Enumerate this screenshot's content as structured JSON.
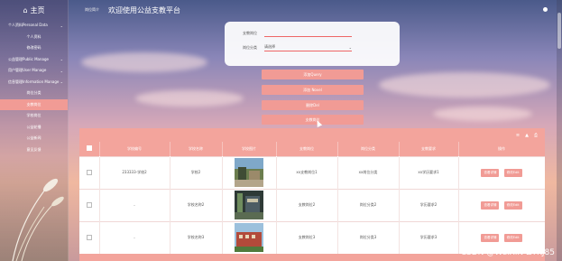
{
  "sidebar": {
    "brand": "主页",
    "items": [
      {
        "label": "个人资料Personal Data",
        "type": "group"
      },
      {
        "label": "个人资料",
        "type": "item"
      },
      {
        "label": "修改密码",
        "type": "item"
      },
      {
        "label": "公益管理Public Manage",
        "type": "group"
      },
      {
        "label": "用户管理User Manage",
        "type": "group"
      },
      {
        "label": "信息管理Information Manage",
        "type": "group"
      },
      {
        "label": "岗位分类",
        "type": "item"
      },
      {
        "label": "支教岗位",
        "type": "item",
        "active": true
      },
      {
        "label": "学校岗位",
        "type": "item"
      },
      {
        "label": "公益轮播",
        "type": "item"
      },
      {
        "label": "公益新闻",
        "type": "item"
      },
      {
        "label": "意见反馈",
        "type": "item"
      }
    ]
  },
  "header": {
    "breadcrumb": "岗位简介",
    "title": "欢迎使用公益支教平台"
  },
  "search": {
    "field1_label": "支教岗位",
    "field1_placeholder": "",
    "field2_label": "岗位分类",
    "field2_value": "请选择"
  },
  "actions": [
    {
      "label": "添加Query"
    },
    {
      "label": "添加 Novel"
    },
    {
      "label": "删除Del"
    },
    {
      "label": "支教岗位"
    }
  ],
  "table": {
    "tools": [
      "≡",
      "▲",
      "⎙"
    ],
    "headers": [
      "",
      "学校编号",
      "学校名称",
      "学校图片",
      "支教岗位",
      "岗位分类",
      "支教要求",
      "操作"
    ],
    "rows": [
      {
        "id": "233333-学校2",
        "name": "学校2",
        "post": "xx支教岗位1",
        "category": "xx岗位分类",
        "req": "xx学历要求1"
      },
      {
        "id": "-",
        "name": "学校名称2",
        "post": "支教岗位2",
        "category": "岗位分类2",
        "req": "学历要求2"
      },
      {
        "id": "-",
        "name": "学校名称3",
        "post": "支教岗位3",
        "category": "岗位分类3",
        "req": "学历要求3"
      }
    ],
    "row_buttons": [
      "查看详情",
      "修改Edit"
    ]
  },
  "watermark": "CSDN @WeiXiN-ZYKJ85",
  "colors": {
    "accent": "#f19b95",
    "white": "#ffffff"
  }
}
